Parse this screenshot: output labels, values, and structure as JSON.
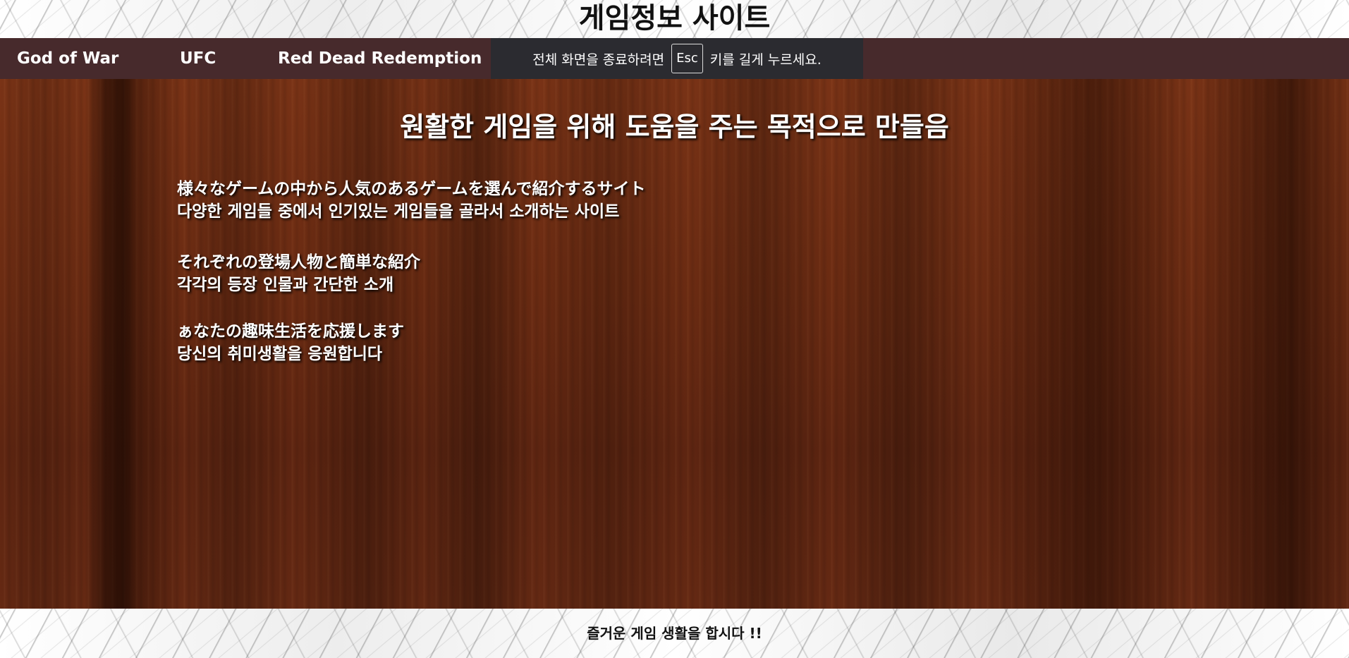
{
  "header": {
    "title": "게임정보 사이트"
  },
  "nav": {
    "items": [
      {
        "label": "God of War"
      },
      {
        "label": "UFC"
      },
      {
        "label": "Red Dead Redemption"
      }
    ]
  },
  "fullscreen_notice": {
    "before": "전체 화면을 종료하려면",
    "key": "Esc",
    "after": "키를 길게 누르세요."
  },
  "main": {
    "heading": "원활한 게임을 위해 도움을 주는 목적으로 만들음",
    "paragraphs": [
      {
        "japanese": "様々なゲームの中から人気のあるゲームを選んで紹介するサイト",
        "korean": "다양한 게임들 중에서 인기있는 게임들을 골라서 소개하는 사이트"
      },
      {
        "japanese": "それぞれの登場人物と簡単な紹介",
        "korean": "각각의 등장 인물과 간단한 소개"
      },
      {
        "japanese": "ぁなたの趣味生活を応援します",
        "korean": "당신의 취미생활을 응원합니다"
      }
    ]
  },
  "footer": {
    "text": "즐거운 게임 생활을 합시다 !!"
  },
  "colors": {
    "nav_background": "#472a2c",
    "notice_background": "#2b2b30",
    "wood_base": "#6b2b12",
    "text_light": "#ffffff",
    "text_dark": "#111111"
  }
}
